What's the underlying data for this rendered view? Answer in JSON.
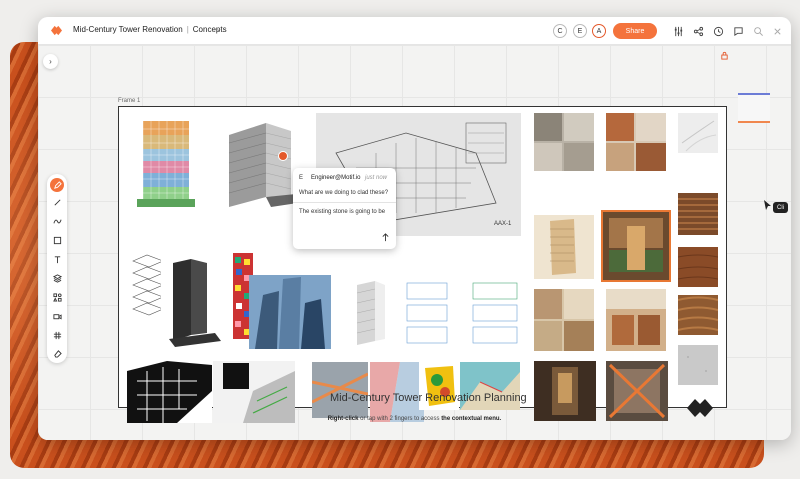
{
  "header": {
    "title": "Mid-Century Tower Renovation",
    "separator": "|",
    "view": "Concepts",
    "avatars": [
      "C",
      "E",
      "A"
    ],
    "share_label": "Share"
  },
  "canvas": {
    "frame_label": "Frame 1",
    "frame_title": "Mid-Century Tower Renovation Planning",
    "drawing_tag": "AAX-1"
  },
  "comment": {
    "avatar": "E",
    "user": "Engineer@Motif.io",
    "time": "just now",
    "message": "What are we doing to clad these?",
    "reply_text": "The existing stone is going to be"
  },
  "hint": {
    "part1": "Right-click",
    "part2": " or tap with 2 fingers to access ",
    "part3": "the contextual menu."
  },
  "cursor_label": "Cli",
  "colors": {
    "accent": "#f4733c",
    "minimap_top": "#6c7cd6",
    "minimap_bottom": "#f0874e"
  },
  "toolbar_icons": [
    "pen-icon",
    "line-icon",
    "freehand-icon",
    "rectangle-icon",
    "text-icon",
    "layers-icon",
    "components-icon",
    "video-icon",
    "grid-icon",
    "eraser-icon"
  ]
}
